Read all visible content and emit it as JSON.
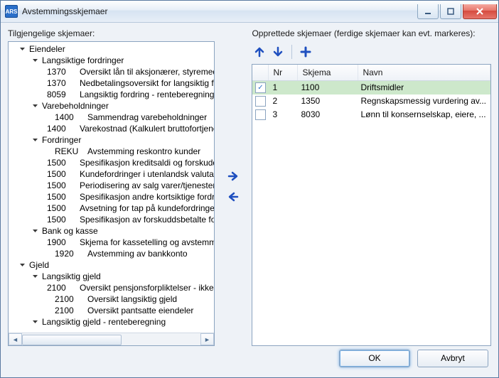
{
  "window": {
    "title": "Avstemmingsskjemaer",
    "app_icon_text": "ARS"
  },
  "left": {
    "label": "Tilgjengelige skjemaer:"
  },
  "right": {
    "label": "Opprettede skjemaer (ferdige skjemaer kan evt. markeres):",
    "columns": {
      "nr": "Nr",
      "skjema": "Skjema",
      "navn": "Navn"
    },
    "rows": [
      {
        "checked": true,
        "nr": "1",
        "skjema": "1100",
        "navn": "Driftsmidler",
        "selected": true
      },
      {
        "checked": false,
        "nr": "2",
        "skjema": "1350",
        "navn": "Regnskapsmessig vurdering av..."
      },
      {
        "checked": false,
        "nr": "3",
        "skjema": "8030",
        "navn": "Lønn til konsernselskap, eiere, ..."
      }
    ]
  },
  "tree": [
    {
      "depth": 0,
      "expand": "open",
      "label": "Eiendeler"
    },
    {
      "depth": 1,
      "expand": "open",
      "label": "Langsiktige fordringer"
    },
    {
      "depth": 2,
      "code": "1370",
      "label": "Oversikt lån til aksjonærer, styremedle"
    },
    {
      "depth": 2,
      "code": "1370",
      "label": "Nedbetalingsoversikt for langsiktig ford"
    },
    {
      "depth": 2,
      "code": "8059",
      "label": "Langsiktig fordring - renteberegning"
    },
    {
      "depth": 1,
      "expand": "open",
      "label": "Varebeholdninger"
    },
    {
      "depth": 2,
      "code": "1400",
      "label": "Sammendrag varebeholdninger"
    },
    {
      "depth": 2,
      "code": "1400",
      "label": "Varekostnad (Kalkulert bruttofortjenes"
    },
    {
      "depth": 1,
      "expand": "open",
      "label": "Fordringer"
    },
    {
      "depth": 2,
      "code": "REKU",
      "label": "Avstemming reskontro kunder"
    },
    {
      "depth": 2,
      "code": "1500",
      "label": "Spesifikasjon kreditsaldi og forskudd k"
    },
    {
      "depth": 2,
      "code": "1500",
      "label": "Kundefordringer i utenlandsk valuta, p"
    },
    {
      "depth": 2,
      "code": "1500",
      "label": "Periodisering av salg varer/tjenester"
    },
    {
      "depth": 2,
      "code": "1500",
      "label": "Spesifikasjon andre kortsiktige fordring"
    },
    {
      "depth": 2,
      "code": "1500",
      "label": "Avsetning for tap på kundefordringer"
    },
    {
      "depth": 2,
      "code": "1500",
      "label": "Spesifikasjon av forskuddsbetalte ford"
    },
    {
      "depth": 1,
      "expand": "open",
      "label": "Bank og kasse"
    },
    {
      "depth": 2,
      "code": "1900",
      "label": "Skjema for kassetelling og avstemming"
    },
    {
      "depth": 2,
      "code": "1920",
      "label": "Avstemming av bankkonto"
    },
    {
      "depth": 0,
      "expand": "open",
      "label": "Gjeld"
    },
    {
      "depth": 1,
      "expand": "open",
      "label": "Langsiktig gjeld"
    },
    {
      "depth": 2,
      "code": "2100",
      "label": "Oversikt pensjonsforpliktelser - ikke fo"
    },
    {
      "depth": 2,
      "code": "2100",
      "label": "Oversikt langsiktig gjeld"
    },
    {
      "depth": 2,
      "code": "2100",
      "label": "Oversikt pantsatte eiendeler"
    },
    {
      "depth": 1,
      "expand": "open",
      "label": "Langsiktig gjeld - renteberegning"
    }
  ],
  "buttons": {
    "ok": "OK",
    "cancel": "Avbryt"
  },
  "colors": {
    "accent": "#2a6fc9",
    "selected_row": "#cde8cb"
  }
}
